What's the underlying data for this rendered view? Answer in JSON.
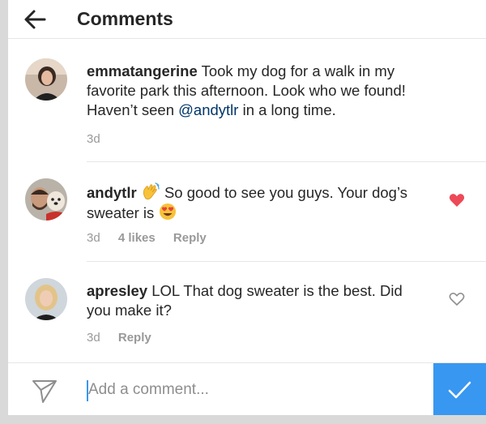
{
  "header": {
    "title": "Comments"
  },
  "comments": [
    {
      "username": "emmatangerine",
      "text_before": "Took my dog for a walk in my favorite park this afternoon. Look who we found! Haven’t seen ",
      "mention": "@andytlr",
      "text_after": " in a long time.",
      "time": "3d",
      "liked": false
    },
    {
      "username": "andytlr",
      "text_a": "So good to see you guys. Your dog’s sweater is",
      "time": "3d",
      "likes": "4 likes",
      "reply": "Reply",
      "liked": true
    },
    {
      "username": "apresley",
      "text": "LOL That dog sweater is the best. Did you make it?",
      "time": "3d",
      "reply": "Reply",
      "liked": false
    }
  ],
  "composer": {
    "placeholder": "Add a comment..."
  },
  "colors": {
    "accent": "#3897f0",
    "heart": "#ed4956",
    "mention": "#003569",
    "meta": "#999999"
  }
}
